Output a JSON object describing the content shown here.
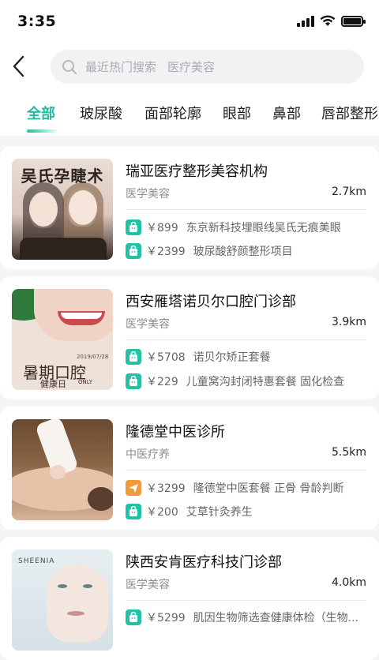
{
  "status": {
    "time": "3:35"
  },
  "search": {
    "hint1": "最近热门搜索",
    "hint2": "医疗美容"
  },
  "tabs": [
    "全部",
    "玻尿酸",
    "面部轮廓",
    "眼部",
    "鼻部",
    "唇部整形"
  ],
  "colors": {
    "accent": "#1dbe9f",
    "deal_green": "#25c1a6",
    "deal_orange": "#f29a3b"
  },
  "cards": [
    {
      "name": "瑞亚医疗整形美容机构",
      "category": "医学美容",
      "distance": "2.7km",
      "thumb_text": "吴氏孕睫术",
      "deals": [
        {
          "icon": "bag-icon",
          "price": "￥899",
          "desc": "东京新科技埋眼线吴氏无痕美眼"
        },
        {
          "icon": "bag-icon",
          "price": "￥2399",
          "desc": "玻尿酸舒颜整形项目"
        }
      ]
    },
    {
      "name": "西安雁塔诺贝尔口腔门诊部",
      "category": "医学美容",
      "distance": "3.9km",
      "thumb_text": "暑期口腔",
      "thumb_sub": "健康日",
      "thumb_date": "2019/07/28",
      "thumb_only": "ONLY",
      "deals": [
        {
          "icon": "bag-icon",
          "price": "￥5708",
          "desc": "诺贝尔矫正套餐"
        },
        {
          "icon": "bag-icon",
          "price": "￥229",
          "desc": "儿童窝沟封闭特惠套餐 固化检查"
        }
      ]
    },
    {
      "name": "隆德堂中医诊所",
      "category": "中医疗养",
      "distance": "5.5km",
      "deals": [
        {
          "icon": "plane-icon",
          "price": "￥3299",
          "desc": "隆德堂中医套餐 正骨 骨龄判断"
        },
        {
          "icon": "bag-icon",
          "price": "￥200",
          "desc": "艾草针灸养生"
        }
      ]
    },
    {
      "name": "陕西安肯医疗科技门诊部",
      "category": "医学美容",
      "distance": "4.0km",
      "thumb_text": "SHEENIA",
      "deals": [
        {
          "icon": "bag-icon",
          "price": "￥5299",
          "desc": "肌因生物筛选查健康体检（生物..."
        }
      ]
    }
  ]
}
